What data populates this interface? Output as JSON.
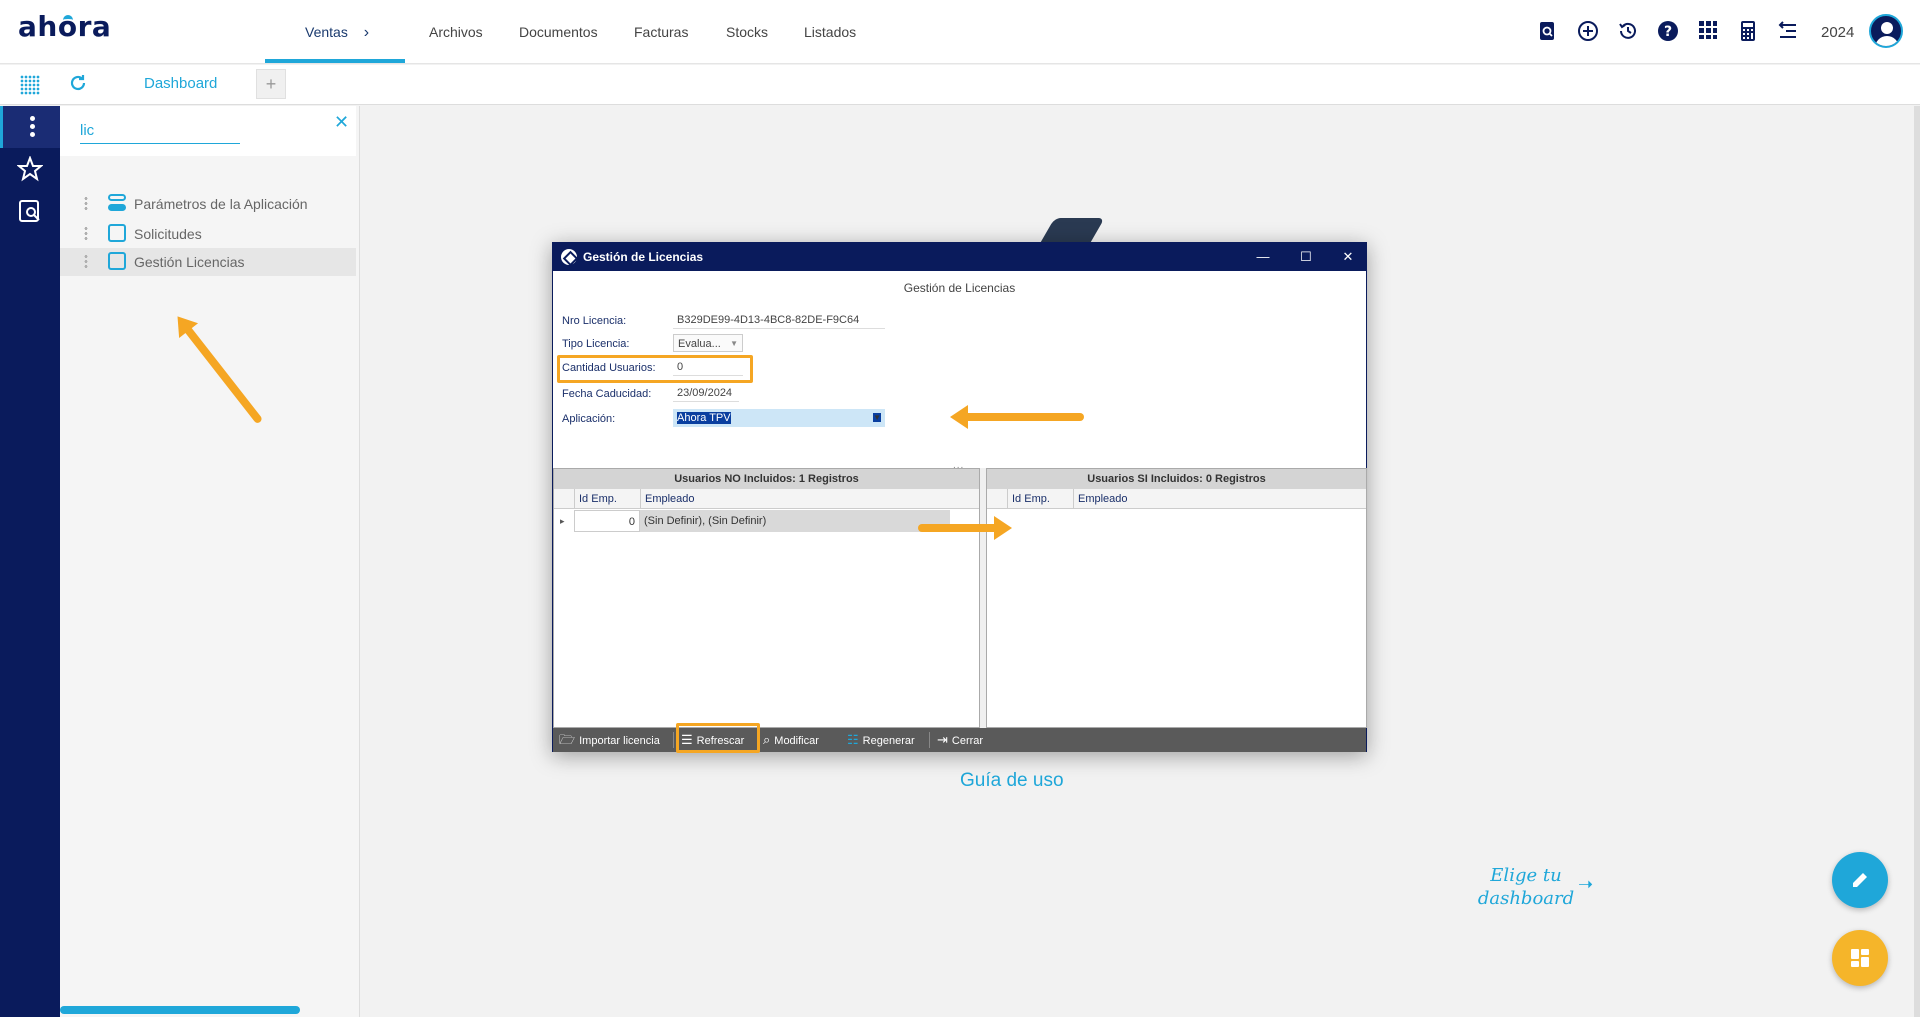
{
  "app": {
    "logo": "ahora"
  },
  "topnav": {
    "items": [
      "Ventas",
      "Archivos",
      "Documentos",
      "Facturas",
      "Stocks",
      "Listados"
    ],
    "active_chevron": "›",
    "year": "2024",
    "icons": [
      "search-document-icon",
      "add-circle-icon",
      "history-icon",
      "help-icon",
      "apps-grid-icon",
      "calculator-icon",
      "exchange-icon"
    ]
  },
  "tabs": {
    "dashboard": "Dashboard",
    "add": "+"
  },
  "search": {
    "value": "lic",
    "close": "✕"
  },
  "results": [
    {
      "label": "Parámetros de la Aplicación"
    },
    {
      "label": "Solicitudes"
    },
    {
      "label": "Gestión Licencias"
    }
  ],
  "main": {
    "guia": "Guía de uso",
    "elige": "Elige tu dashboard",
    "elige_arrow": "➝"
  },
  "dialog": {
    "title": "Gestión de Licencias",
    "header": "Gestión de Licencias",
    "win": {
      "minimize": "—",
      "maximize": "☐",
      "close": "✕"
    },
    "fields": {
      "nro_label": "Nro Licencia:",
      "nro_value": "B329DE99-4D13-4BC8-82DE-F9C64",
      "tipo_label": "Tipo Licencia:",
      "tipo_value": "Evalua...",
      "cant_label": "Cantidad Usuarios:",
      "cant_value": "0",
      "fecha_label": "Fecha Caducidad:",
      "fecha_value": "23/09/2024",
      "app_label": "Aplicación:",
      "app_value": "Ahora TPV"
    },
    "dots": "...",
    "grid_left": {
      "caption": "Usuarios NO Incluidos: 1 Registros",
      "cols": [
        "Id Emp.",
        "Empleado"
      ],
      "rows": [
        {
          "marker": "▸",
          "id": "0",
          "empleado": "(Sin Definir), (Sin Definir)"
        }
      ]
    },
    "grid_right": {
      "caption": "Usuarios SI Incluidos: 0 Registros",
      "cols": [
        "Id Emp.",
        "Empleado"
      ]
    },
    "footer": {
      "importar": "Importar licencia",
      "refrescar": "Refrescar",
      "modificar": "Modificar",
      "regenerar": "Regenerar",
      "cerrar": "Cerrar"
    }
  },
  "colors": {
    "navy": "#0a1b5c",
    "accent": "#1fa7d9",
    "highlight": "#f5a623"
  }
}
